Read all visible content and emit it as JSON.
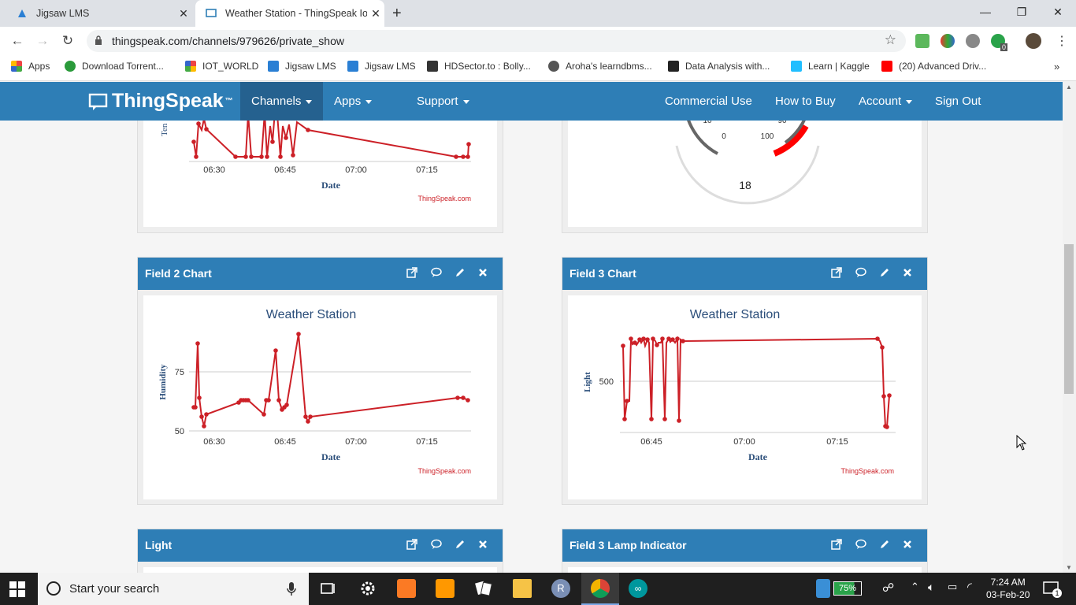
{
  "browser": {
    "tabs": [
      {
        "title": "Jigsaw LMS",
        "active": false
      },
      {
        "title": "Weather Station - ThingSpeak Io",
        "active": true
      }
    ],
    "url": "thingspeak.com/channels/979626/private_show",
    "bookmarks": [
      "Apps",
      "Download Torrent...",
      "IOT_WORLD",
      "Jigsaw LMS",
      "Jigsaw LMS",
      "HDSector.to : Bolly...",
      "Aroha's learndbms...",
      "Data Analysis with...",
      "Learn | Kaggle",
      "(20) Advanced Driv..."
    ],
    "extension_badge": "0"
  },
  "navbar": {
    "brand": "ThingSpeak",
    "tm": "™",
    "left_items": [
      "Channels",
      "Apps",
      "Support"
    ],
    "right_items": [
      "Commercial Use",
      "How to Buy",
      "Account",
      "Sign Out"
    ]
  },
  "widgets": {
    "top_left": {
      "ylabel": "Ten",
      "xlabel": "Date",
      "credit": "ThingSpeak.com",
      "ticks": [
        "06:30",
        "06:45",
        "07:00",
        "07:15"
      ]
    },
    "top_right": {
      "gauge_labels": [
        "10",
        "0",
        "90",
        "100"
      ],
      "value": "18"
    },
    "field2": {
      "title": "Field 2 Chart",
      "chart_title": "Weather Station",
      "ylabel": "Humidity",
      "xlabel": "Date",
      "credit": "ThingSpeak.com",
      "yticks": [
        "75",
        "50"
      ],
      "xticks": [
        "06:30",
        "06:45",
        "07:00",
        "07:15"
      ]
    },
    "field3": {
      "title": "Field 3 Chart",
      "chart_title": "Weather Station",
      "ylabel": "Light",
      "xlabel": "Date",
      "credit": "ThingSpeak.com",
      "yticks": [
        "500"
      ],
      "xticks": [
        "06:45",
        "07:00",
        "07:15"
      ]
    },
    "light": {
      "title": "Light"
    },
    "lamp": {
      "title": "Field 3 Lamp Indicator"
    }
  },
  "chart_data": [
    {
      "type": "line",
      "title": "Weather Station",
      "ylabel": "Humidity",
      "xlabel": "Date",
      "series": [
        {
          "x": [
            "06:25",
            "06:26",
            "06:27",
            "06:27.5",
            "06:28",
            "06:29",
            "06:30",
            "06:37",
            "06:38",
            "06:39",
            "06:40",
            "06:41",
            "06:42",
            "06:43",
            "06:44",
            "06:45",
            "06:46",
            "06:47",
            "06:48",
            "06:49",
            "06:50",
            "06:51",
            "06:52",
            "06:53",
            "07:20",
            "07:21",
            "07:22"
          ],
          "values": [
            60,
            60,
            87,
            64,
            56,
            52,
            57,
            62,
            63,
            63,
            63,
            63,
            57,
            63,
            63,
            84,
            63,
            59,
            60,
            61,
            91,
            56,
            54,
            56,
            64,
            64,
            63
          ],
          "color": "#cc2027"
        }
      ]
    },
    {
      "type": "line",
      "title": "Weather Station",
      "ylabel": "Light",
      "xlabel": "Date",
      "series": [
        {
          "x": [
            "06:40",
            "06:41",
            "06:42",
            "06:43",
            "06:44",
            "06:45",
            "06:46",
            "06:47",
            "06:48",
            "06:49",
            "06:50",
            "06:51",
            "06:52",
            "06:53",
            "07:19",
            "07:20",
            "07:21",
            "07:22"
          ],
          "values": [
            540,
            590,
            600,
            600,
            590,
            590,
            455,
            590,
            600,
            590,
            455,
            600,
            590,
            455,
            600,
            590,
            500,
            440
          ],
          "color": "#cc2027"
        }
      ]
    }
  ],
  "taskbar": {
    "search_placeholder": "Start your search",
    "battery": "75%",
    "time": "7:24 AM",
    "date": "03-Feb-20",
    "notif": "1"
  }
}
